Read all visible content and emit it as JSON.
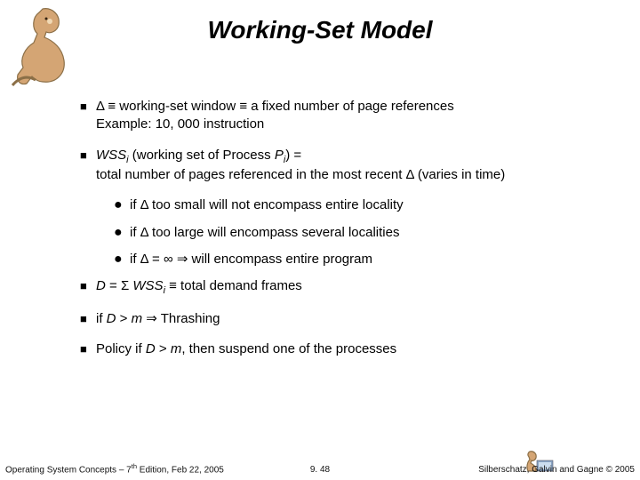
{
  "title": "Working-Set Model",
  "bullets": {
    "b1_line1": "Δ ≡ working-set window ≡ a fixed number of page references",
    "b1_line2": "Example:  10, 000 instruction",
    "b2_var": "WSS",
    "b2_sub": "i",
    "b2_rest": " (working set of Process ",
    "b2_pi_p": "P",
    "b2_pi_i": "i",
    "b2_after": ") =",
    "b2_line2": "total number of pages referenced in the most recent Δ (varies in time)",
    "s1": "if Δ too small will not encompass entire locality",
    "s2": "if Δ too large will encompass several localities",
    "s3": "if Δ = ∞ ⇒ will encompass entire program",
    "b3_pre": "",
    "b3_d": "D",
    "b3_eq": " = Σ ",
    "b3_wss": "WSS",
    "b3_i": "i",
    "b3_after": " ≡ total demand frames",
    "b4": "if ",
    "b4_d": "D",
    "b4_mid": " > ",
    "b4_m": "m",
    "b4_after": " ⇒ Thrashing",
    "b5": "Policy if ",
    "b5_d": "D",
    "b5_mid": " > ",
    "b5_m": "m",
    "b5_after": ", then suspend one of the processes"
  },
  "footer": {
    "left_pre": "Operating System Concepts – 7",
    "left_sup": "th",
    "left_post": " Edition, Feb 22, 2005",
    "center": "9. 48",
    "right": "Silberschatz, Galvin and Gagne © 2005"
  }
}
